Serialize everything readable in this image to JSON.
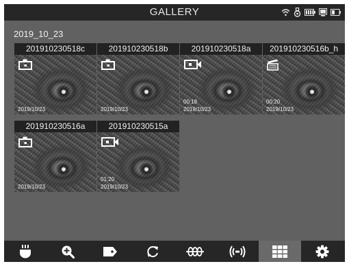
{
  "header": {
    "title": "GALLERY"
  },
  "status_icons": [
    "wifi-icon",
    "camera-probe-icon",
    "battery-icon",
    "monitor-icon",
    "device-battery-icon"
  ],
  "section": {
    "date": "2019_10_23"
  },
  "items": [
    {
      "name": "201910230518c",
      "type": "photo",
      "duration": "",
      "date": "2019/10/23"
    },
    {
      "name": "201910230518b",
      "type": "photo",
      "duration": "",
      "date": "2019/10/23"
    },
    {
      "name": "201910230518a",
      "type": "video",
      "duration": "00:18",
      "date": "2019/10/23"
    },
    {
      "name": "201910230516b_h",
      "type": "clip",
      "duration": "00:20",
      "date": "2019/10/23"
    },
    {
      "name": "201910230516a",
      "type": "photo",
      "duration": "",
      "date": "2019/10/23"
    },
    {
      "name": "201910230515a",
      "type": "video",
      "duration": "01:20",
      "date": "2019/10/23"
    }
  ],
  "toolbar": [
    {
      "name": "light-icon",
      "active": false
    },
    {
      "name": "zoom-in-icon",
      "active": false
    },
    {
      "name": "tag-icon",
      "active": false
    },
    {
      "name": "rotate-icon",
      "active": false
    },
    {
      "name": "filter-icon",
      "active": false
    },
    {
      "name": "signal-icon",
      "active": false
    },
    {
      "name": "gallery-grid-icon",
      "active": true
    },
    {
      "name": "settings-gear-icon",
      "active": false
    }
  ],
  "colors": {
    "background": "#616161",
    "bar": "#262626",
    "active": "#6a6a6a",
    "text": "#f2f2f2"
  }
}
